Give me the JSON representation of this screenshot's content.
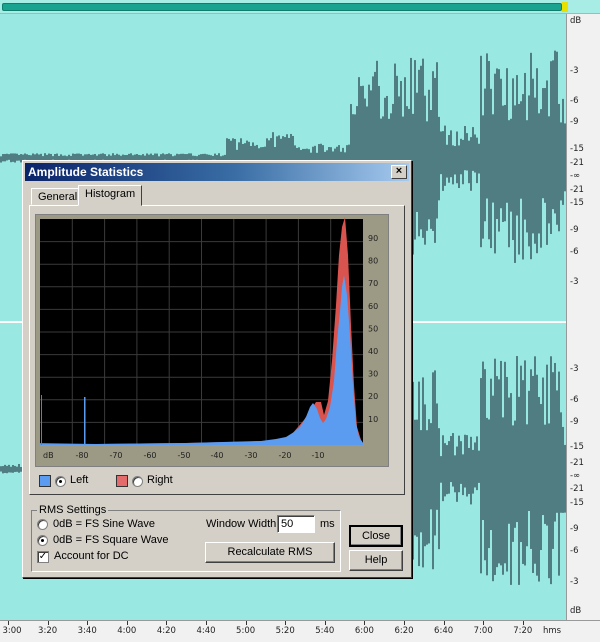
{
  "editor": {
    "amplitude_ruler": {
      "top_channel": [
        "dB",
        "-3",
        "-6",
        "-9",
        "-15",
        "-21",
        "-∞",
        "-21",
        "-15",
        "-9",
        "-6",
        "-3"
      ],
      "bottom_channel": [
        "-3",
        "-6",
        "-9",
        "-15",
        "-21",
        "-∞",
        "-21",
        "-15",
        "-9",
        "-6",
        "-3",
        "dB"
      ]
    },
    "time_ruler": {
      "labels": [
        "3:00",
        "3:20",
        "3:40",
        "4:00",
        "4:20",
        "4:40",
        "5:00",
        "5:20",
        "5:40",
        "6:00",
        "6:20",
        "6:40",
        "7:00",
        "7:20"
      ],
      "unit": "hms"
    },
    "colors": {
      "background": "#9ae8e2",
      "waveform": "#4f7d82",
      "ruler": "#f1f1f1"
    }
  },
  "dialog": {
    "title": "Amplitude Statistics",
    "close_glyph": "×",
    "tabs": [
      {
        "label": "General",
        "selected": false
      },
      {
        "label": "Histogram",
        "selected": true
      }
    ],
    "histogram": {
      "x_tick_labels": [
        "dB",
        "-80",
        "-70",
        "-60",
        "-50",
        "-40",
        "-30",
        "-20",
        "-10"
      ],
      "y_tick_labels": [
        "90",
        "80",
        "70",
        "60",
        "50",
        "40",
        "30",
        "20",
        "10"
      ],
      "colors": {
        "left": "#5b9cf0",
        "right": "#d9534f",
        "plot_background": "#000000",
        "grid": "#3a3a3a"
      }
    },
    "legend": {
      "left_label": "Left",
      "right_label": "Right",
      "selected": "left"
    },
    "rms_settings": {
      "group_label": "RMS Settings",
      "options": [
        {
          "label": "0dB = FS Sine Wave",
          "selected": false
        },
        {
          "label": "0dB = FS Square Wave",
          "selected": true
        }
      ],
      "account_for_dc_label": "Account for DC",
      "account_for_dc_checked": true,
      "window_width_label": "Window Width:",
      "window_width_value": "50",
      "window_width_unit": "ms",
      "recalculate_label": "Recalculate RMS"
    },
    "buttons": {
      "close": "Close",
      "help": "Help"
    }
  }
}
